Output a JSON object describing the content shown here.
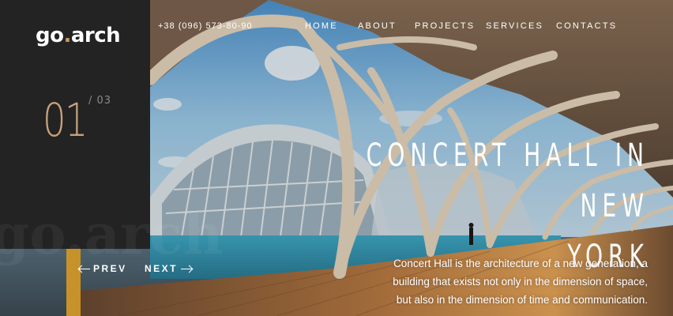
{
  "brand": {
    "logo_main": "go",
    "logo_dot": ".",
    "logo_rest": "arch",
    "ghost_text": "go.arch"
  },
  "header": {
    "phone": "+38 (096) 573-80-90",
    "nav": [
      "HOME",
      "ABOUT",
      "PROJECTS",
      "SERVICES",
      "CONTACTS"
    ]
  },
  "slider": {
    "current": "01",
    "total": "/ 03",
    "title_line1": "CONCERT HALL IN NEW",
    "title_line2": "YORK",
    "description": "Concert Hall is the architecture of a new generation, a building that exists not only in the dimension of space, but also in the dimension of time and communication.",
    "prev_label": "PREV",
    "next_label": "NEXT"
  },
  "icons": {
    "prev": "arrow-left-icon",
    "next": "arrow-right-icon"
  },
  "colors": {
    "panel": "#232323",
    "accent_gold": "#c8922a",
    "number": "#c7a27a"
  }
}
